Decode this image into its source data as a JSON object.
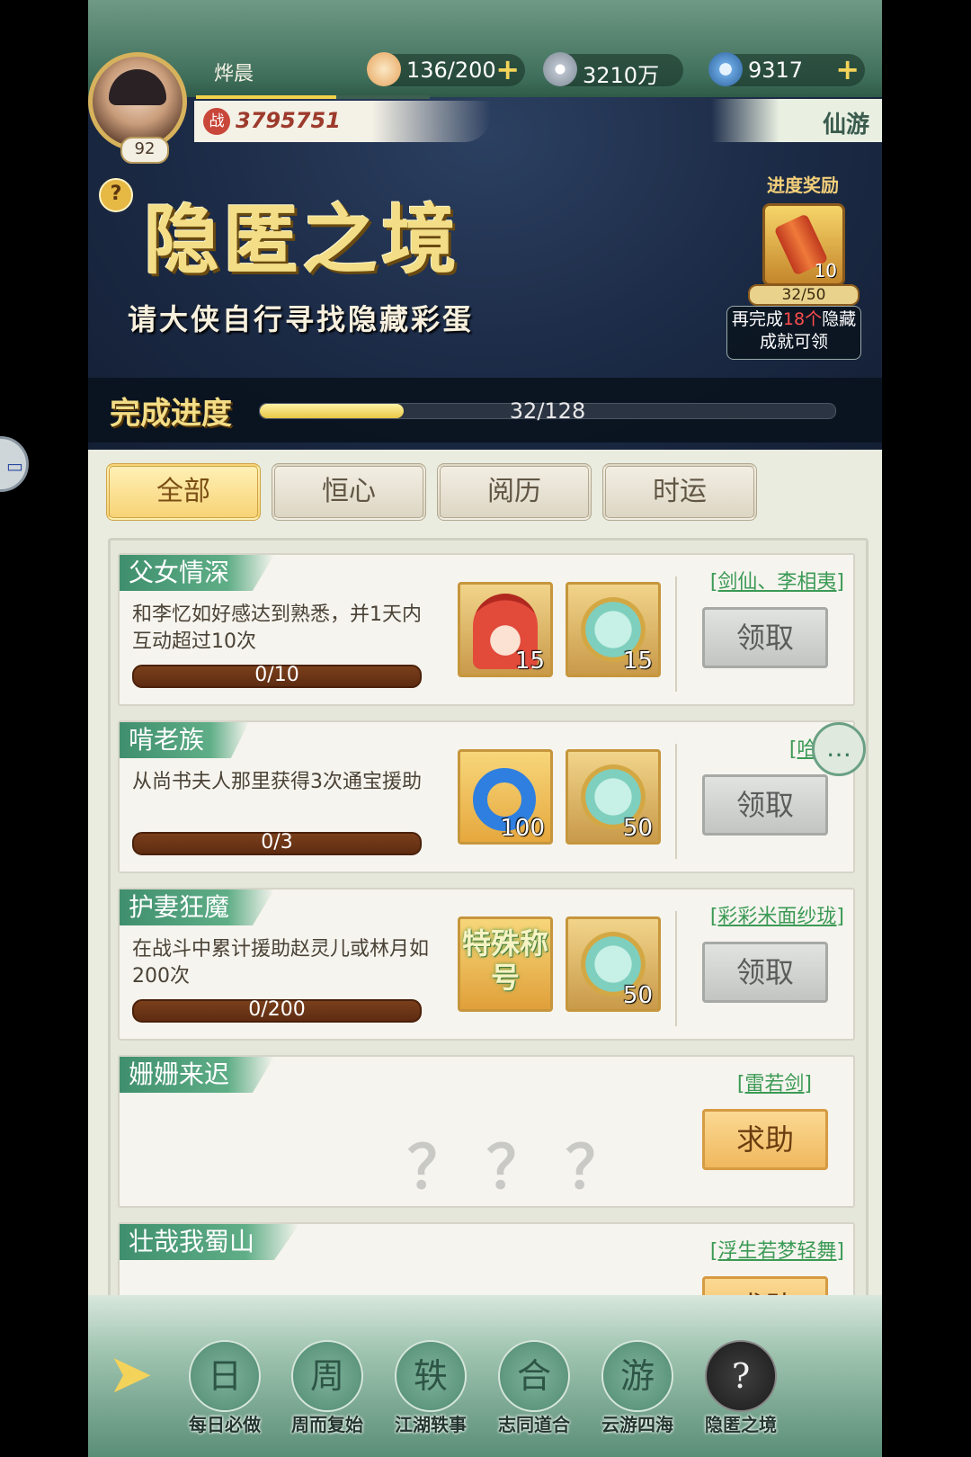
{
  "player": {
    "name": "烨晨",
    "level": "92",
    "power": "3795751",
    "power_tag": "战"
  },
  "resources": [
    {
      "icon": "bun-icon",
      "value": "136/200",
      "has_plus": true
    },
    {
      "icon": "coin-icon",
      "value": "3210万",
      "has_plus": false
    },
    {
      "icon": "jade-swirl-icon",
      "value": "9317",
      "has_plus": true
    }
  ],
  "mode_label": "仙游",
  "banner": {
    "title": "隐匿之境",
    "subtitle": "请大侠自行寻找隐藏彩蛋"
  },
  "progress_reward": {
    "label": "进度奖励",
    "item_count": "10",
    "progress": "32/50",
    "tip_prefix": "再完成",
    "tip_highlight": "18个",
    "tip_suffix": "隐藏成就可领"
  },
  "completion": {
    "label": "完成进度",
    "text": "32/128",
    "fraction": 0.25
  },
  "tabs": [
    "全部",
    "恒心",
    "阅历",
    "时运"
  ],
  "active_tab": 0,
  "tasks": [
    {
      "name": "父女情深",
      "desc": "和李忆如好感达到熟悉，并1天内互动超过10次",
      "progress": "0/10",
      "rewards": [
        {
          "kind": "portrait",
          "count": "15"
        },
        {
          "kind": "jade-token",
          "count": "15"
        }
      ],
      "tag": "[剑仙、李相夷]",
      "button": "领取"
    },
    {
      "name": "啃老族",
      "desc": "从尚书夫人那里获得3次通宝援助",
      "progress": "0/3",
      "rewards": [
        {
          "kind": "blue-ring",
          "count": "100"
        },
        {
          "kind": "jade-token",
          "count": "50"
        }
      ],
      "tag": "[哈哈]",
      "button": "领取"
    },
    {
      "name": "护妻狂魔",
      "desc": "在战斗中累计援助赵灵儿或林月如200次",
      "progress": "0/200",
      "rewards": [
        {
          "kind": "special-title",
          "label": "特殊称号"
        },
        {
          "kind": "jade-token",
          "count": "50"
        }
      ],
      "tag": "[彩彩米面纱珑]",
      "button": "领取"
    },
    {
      "name": "姗姗来迟",
      "hidden": "？？？",
      "tag": "[雷若剑]",
      "button": "求助"
    },
    {
      "name": "壮哉我蜀山",
      "hidden": "？？？",
      "tag": "[浮生若梦轻舞]",
      "button": "求助"
    }
  ],
  "nav": [
    {
      "label": "每日必做",
      "glyph": "日"
    },
    {
      "label": "周而复始",
      "glyph": "周"
    },
    {
      "label": "江湖轶事",
      "glyph": "轶"
    },
    {
      "label": "志同道合",
      "glyph": "合"
    },
    {
      "label": "云游四海",
      "glyph": "游"
    },
    {
      "label": "隐匿之境",
      "glyph": "?"
    }
  ],
  "active_nav": 5
}
